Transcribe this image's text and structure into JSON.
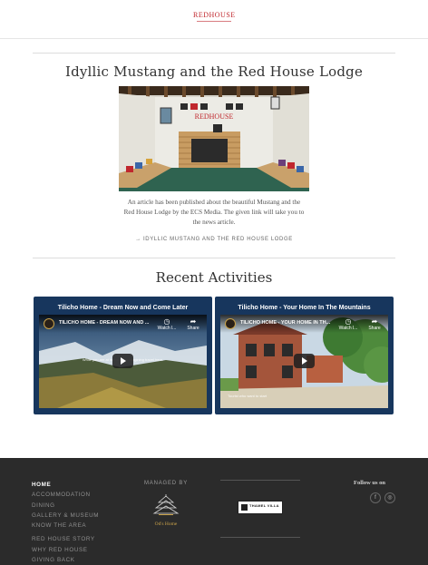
{
  "header": {
    "logo_text": "REDHOUSE"
  },
  "article": {
    "title": "Idyllic Mustang and the Red House Lodge",
    "photo_sign": "REDHOUSE",
    "body": "An article has been published about the beautiful Mustang and the Red House Lodge by the ECS Media. The given link will take you to the news article.",
    "link": "→ IDYLLIC MUSTANG AND THE RED HOUSE LODGE"
  },
  "recent": {
    "title": "Recent Activities",
    "videos": [
      {
        "card_title": "Tilicho Home - Dream Now and Come Later",
        "player_title": "TILICHO HOME - DREAM NOW AND ...",
        "watch_label": "Watch l...",
        "share_label": "Share",
        "caption": "While you are at home keep imagining travel here."
      },
      {
        "card_title": "Tilicho Home - Your Home In The Mountains",
        "player_title": "TILICHO HOME - YOUR HOME IN TH...",
        "watch_label": "Watch l...",
        "share_label": "Share",
        "caption": "Tourist who want to start"
      }
    ]
  },
  "footer": {
    "nav_primary": [
      "HOME",
      "ACCOMMODATION",
      "DINING",
      "GALLERY & MUSEUM",
      "KNOW THE AREA"
    ],
    "nav_secondary": [
      "RED HOUSE STORY",
      "WHY RED HOUSE",
      "GIVING BACK"
    ],
    "managed_by": "MANAGED BY",
    "managed_logo_text": "Od's Home",
    "partner_logo_text": "THAMEL VILLA",
    "follow_us": "Follow us on",
    "social": [
      {
        "icon": "facebook-icon",
        "glyph": "f"
      },
      {
        "icon": "instagram-icon",
        "glyph": "◎"
      }
    ]
  },
  "colors": {
    "brand_red": "#c0272d",
    "video_card_bg": "#17365d",
    "footer_bg": "#2b2b2b",
    "accent_gold": "#c9a24a"
  }
}
